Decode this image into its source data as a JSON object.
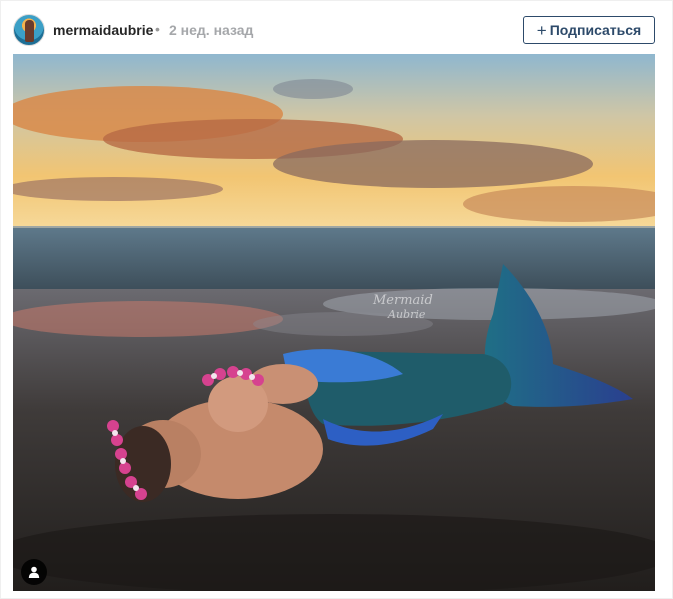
{
  "post": {
    "username": "mermaidaubrie",
    "separator": "•",
    "timestamp": "2 нед. назад",
    "follow": {
      "icon": "plus-icon",
      "label": "Подписаться"
    }
  },
  "photo": {
    "watermark_line1": "Mermaid",
    "watermark_line2": "Aubrie",
    "user_tag_icon": "user-icon"
  },
  "colors": {
    "follow_border": "#2d4a6a",
    "username": "#262626",
    "timestamp": "#a5a7aa"
  }
}
